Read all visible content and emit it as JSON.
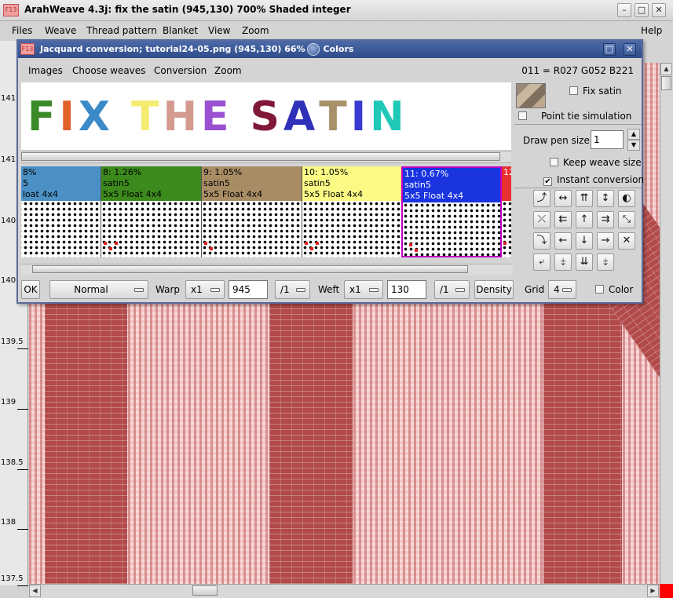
{
  "app": {
    "title": "ArahWeave 4.3j: fix the satin (945,130) 700% Shaded integer",
    "icon_text": "F13",
    "window_buttons": [
      "–",
      "□",
      "✕"
    ]
  },
  "main_menu": {
    "items": [
      "Files",
      "Weave",
      "Thread pattern",
      "Blanket",
      "View",
      "Zoom"
    ],
    "help": "Help"
  },
  "ruler": {
    "labels": [
      "141",
      "141",
      "140",
      "140",
      "139.5",
      "139",
      "138.5",
      "138",
      "137.5"
    ]
  },
  "dialog": {
    "title": "Jacquard conversion; tutorial24-05.png (945,130) 66% 12 Colors",
    "menu": [
      "Images",
      "Choose weaves",
      "Conversion",
      "Zoom"
    ],
    "color_readout": "011 = R027 G052 B221",
    "preview": {
      "letters": [
        {
          "ch": "F",
          "color": "#3a8a2a"
        },
        {
          "ch": "I",
          "color": "#e0602a"
        },
        {
          "ch": "X",
          "color": "#3a8ac8"
        },
        {
          "ch": " ",
          "color": "#ffffff"
        },
        {
          "ch": "T",
          "color": "#f4ec70"
        },
        {
          "ch": "H",
          "color": "#d49a90"
        },
        {
          "ch": "E",
          "color": "#9a50d0"
        },
        {
          "ch": " ",
          "color": "#ffffff"
        },
        {
          "ch": "S",
          "color": "#801838"
        },
        {
          "ch": "A",
          "color": "#3030b8"
        },
        {
          "ch": "T",
          "color": "#a89068"
        },
        {
          "ch": "I",
          "color": "#3a3ad0"
        },
        {
          "ch": "N",
          "color": "#20c8b8"
        }
      ]
    },
    "weaves": [
      {
        "line1": "8%",
        "line2": "5",
        "line3": "loat 4x4",
        "color": "#4a90c4"
      },
      {
        "line1": "8: 1.26%",
        "line2": "satin5",
        "line3": "5x5 Float 4x4",
        "color": "#3c8a1c"
      },
      {
        "line1": "9: 1.05%",
        "line2": "satin5",
        "line3": "5x5 Float 4x4",
        "color": "#a88c64"
      },
      {
        "line1": "10: 1.05%",
        "line2": "satin5",
        "line3": "5x5 Float 4x4",
        "color": "#fafa84"
      },
      {
        "line1": "11: 0.67%",
        "line2": "satin5",
        "line3": "5x5 Float 4x4",
        "color": "#1a34e0"
      },
      {
        "line1": "12",
        "line2": "",
        "line3": "",
        "color": "#e83030"
      }
    ],
    "controls": {
      "fix_satin": "Fix satin",
      "point_tie": "Point tie simulation",
      "draw_pen_label": "Draw pen size",
      "draw_pen_value": "1",
      "keep_weave": "Keep weave size",
      "instant": "Instant conversion"
    },
    "tools": [
      "⤴",
      "↔",
      "⇈",
      "↕",
      "◐",
      "⇇",
      "↑",
      "⇉",
      "⤡",
      "⤫",
      "⤵",
      "←",
      "↓",
      "→",
      "✕",
      "⤶",
      "⤈",
      "⇊",
      "⤈"
    ],
    "bottom": {
      "ok": "OK",
      "mode": "Normal",
      "warp_label": "Warp",
      "warp_mult": "x1",
      "warp_value": "945",
      "warp_div": "/1",
      "weft_label": "Weft",
      "weft_mult": "x1",
      "weft_value": "130",
      "weft_div": "/1",
      "density": "Density",
      "grid_label": "Grid",
      "grid_value": "4",
      "color_label": "Color"
    }
  }
}
